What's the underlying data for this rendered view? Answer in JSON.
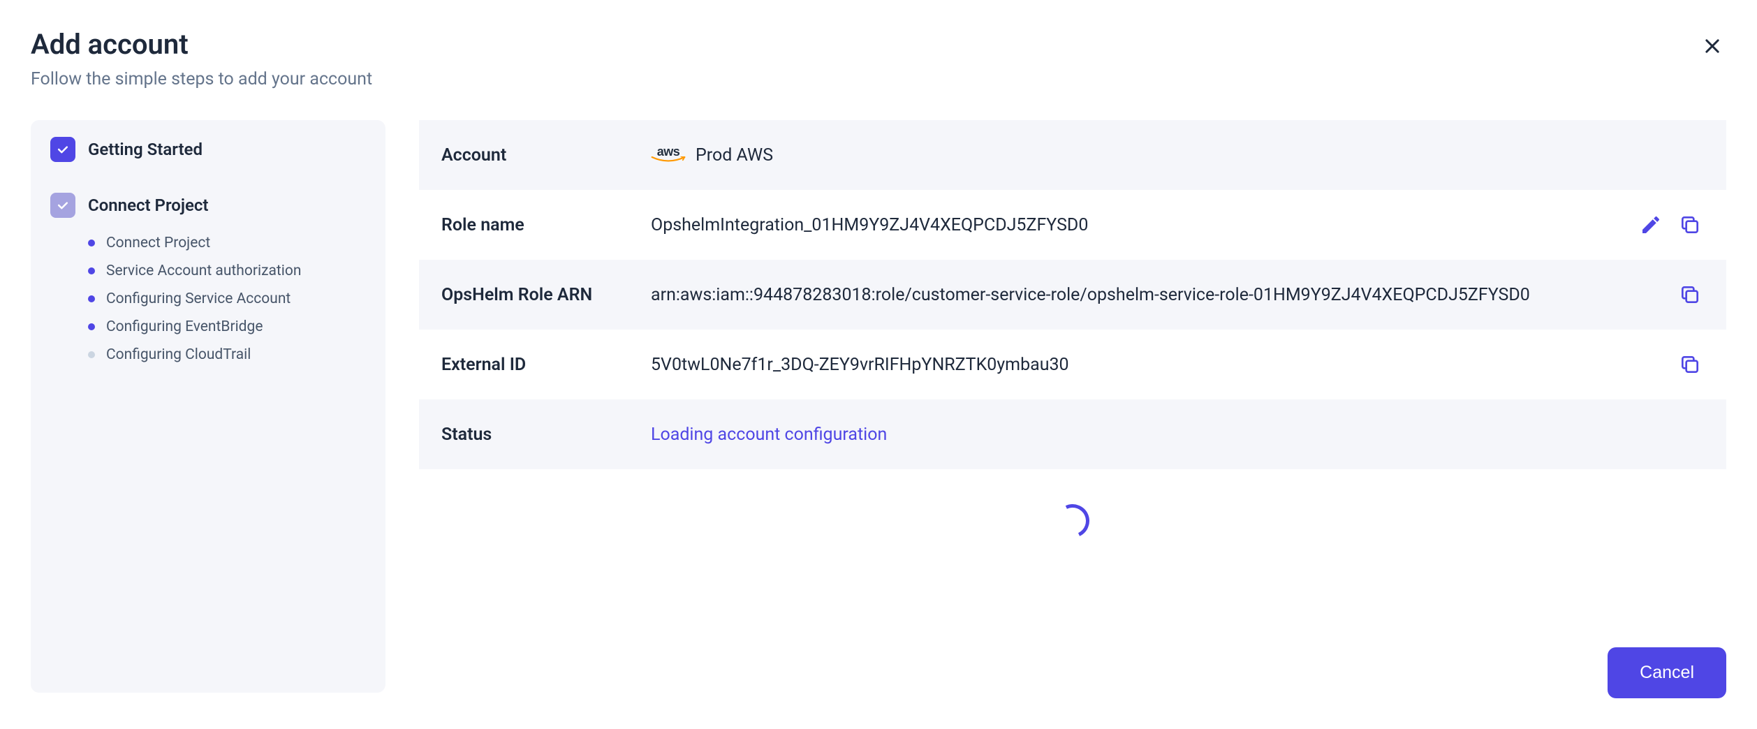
{
  "header": {
    "title": "Add account",
    "subtitle": "Follow the simple steps to add your account"
  },
  "sidebar": {
    "steps": [
      {
        "label": "Getting Started",
        "state": "done"
      },
      {
        "label": "Connect Project",
        "state": "partial"
      }
    ],
    "substeps": [
      {
        "label": "Connect Project",
        "state": "done"
      },
      {
        "label": "Service Account authorization",
        "state": "done"
      },
      {
        "label": "Configuring Service Account",
        "state": "done"
      },
      {
        "label": "Configuring EventBridge",
        "state": "done"
      },
      {
        "label": "Configuring CloudTrail",
        "state": "pending"
      }
    ]
  },
  "details": {
    "account_label": "Account",
    "account_name": "Prod AWS",
    "role_name_label": "Role name",
    "role_name_value": "OpshelmIntegration_01HM9Y9ZJ4V4XEQPCDJ5ZFYSD0",
    "role_arn_label": "OpsHelm Role ARN",
    "role_arn_value": "arn:aws:iam::944878283018:role/customer-service-role/opshelm-service-role-01HM9Y9ZJ4V4XEQPCDJ5ZFYSD0",
    "external_id_label": "External ID",
    "external_id_value": "5V0twL0Ne7f1r_3DQ-ZEY9vrRIFHpYNRZTK0ymbau30",
    "status_label": "Status",
    "status_value": "Loading account configuration"
  },
  "footer": {
    "cancel_label": "Cancel"
  }
}
